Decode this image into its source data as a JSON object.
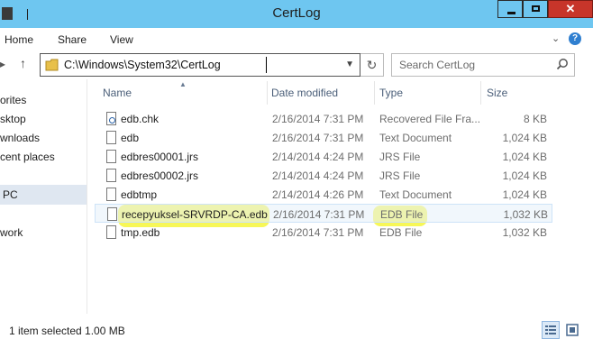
{
  "window": {
    "title": "CertLog"
  },
  "ribbon": {
    "tabs": [
      "Home",
      "Share",
      "View"
    ]
  },
  "address": {
    "path": "C:\\Windows\\System32\\CertLog"
  },
  "search": {
    "placeholder": "Search CertLog"
  },
  "nav_pane": {
    "items": [
      "orites",
      "sktop",
      "wnloads",
      "cent places",
      "PC",
      "work"
    ],
    "selected": "PC"
  },
  "columns": {
    "name": "Name",
    "date": "Date modified",
    "type": "Type",
    "size": "Size"
  },
  "files": [
    {
      "name": "edb.chk",
      "date": "2/16/2014 7:31 PM",
      "type": "Recovered File Fra...",
      "size": "8 KB",
      "icon": "recovered-file-icon",
      "selected": false
    },
    {
      "name": "edb",
      "date": "2/16/2014 7:31 PM",
      "type": "Text Document",
      "size": "1,024 KB",
      "icon": "text-file-icon",
      "selected": false
    },
    {
      "name": "edbres00001.jrs",
      "date": "2/14/2014 4:24 PM",
      "type": "JRS File",
      "size": "1,024 KB",
      "icon": "file-icon",
      "selected": false
    },
    {
      "name": "edbres00002.jrs",
      "date": "2/14/2014 4:24 PM",
      "type": "JRS File",
      "size": "1,024 KB",
      "icon": "file-icon",
      "selected": false
    },
    {
      "name": "edbtmp",
      "date": "2/14/2014 4:26 PM",
      "type": "Text Document",
      "size": "1,024 KB",
      "icon": "text-file-icon",
      "selected": false
    },
    {
      "name": "recepyuksel-SRVRDP-CA.edb",
      "date": "2/16/2014 7:31 PM",
      "type": "EDB File",
      "size": "1,032 KB",
      "icon": "file-icon",
      "selected": true
    },
    {
      "name": "tmp.edb",
      "date": "2/16/2014 7:31 PM",
      "type": "EDB File",
      "size": "1,032 KB",
      "icon": "file-icon",
      "selected": false
    }
  ],
  "status": {
    "text": "1 item selected  1.00 MB"
  },
  "colors": {
    "titlebar": "#6ec6f0",
    "close": "#c7352a",
    "highlight": "#f6f63a",
    "selection": "#e6f0fa"
  }
}
